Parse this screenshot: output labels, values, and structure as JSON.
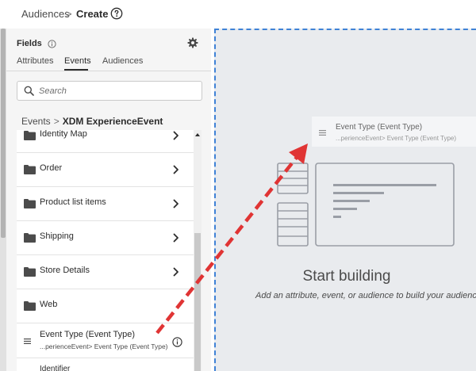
{
  "header": {
    "breadcrumb_root": "Audiences",
    "breadcrumb_sep": ">",
    "breadcrumb_current": "Create"
  },
  "fields_panel": {
    "title": "Fields",
    "tabs": [
      {
        "label": "Attributes"
      },
      {
        "label": "Events"
      },
      {
        "label": "Audiences"
      }
    ],
    "active_tab": "Events",
    "search": {
      "placeholder": "Search",
      "value": ""
    },
    "path": {
      "root": "Events",
      "sep": ">",
      "current": "XDM ExperienceEvent"
    },
    "items": [
      {
        "label": "Identity Map"
      },
      {
        "label": "Order"
      },
      {
        "label": "Product list items"
      },
      {
        "label": "Shipping"
      },
      {
        "label": "Store Details"
      },
      {
        "label": "Web"
      }
    ],
    "event_field": {
      "title": "Event Type (Event Type)",
      "path": "...perienceEvent> Event Type (Event Type)"
    },
    "partial_item": "Identifier"
  },
  "canvas": {
    "ghost": {
      "title": "Event Type (Event Type)",
      "path": "...perienceEvent> Event Type (Event Type)"
    },
    "start_title": "Start building",
    "start_subtitle": "Add an attribute, event, or audience to build your audience."
  },
  "colors": {
    "accent_dashed": "#3f82d6",
    "drag_arrow": "#e03434",
    "canvas_bg": "#e9ebee",
    "panel_bg": "#f5f5f5"
  }
}
